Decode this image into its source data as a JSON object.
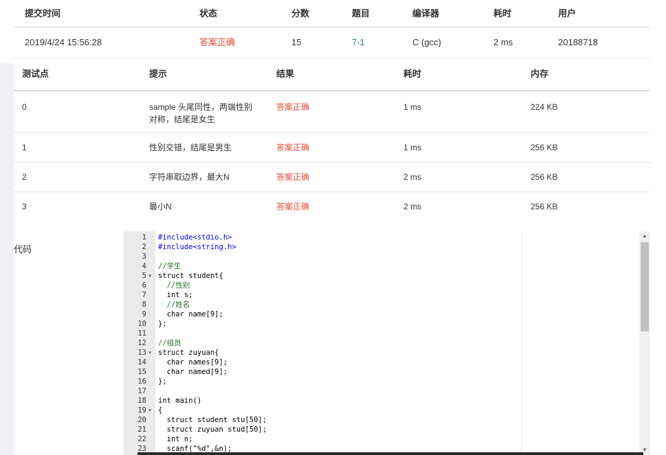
{
  "summary": {
    "headers": [
      "提交时间",
      "状态",
      "分数",
      "题目",
      "编译器",
      "耗时",
      "用户"
    ],
    "row": {
      "time": "2019/4/24 15:56:28",
      "status": "答案正确",
      "score": "15",
      "problem": "7-1",
      "compiler": "C (gcc)",
      "elapsed": "2 ms",
      "user": "20188718"
    }
  },
  "testpoints": {
    "headers": [
      "测试点",
      "提示",
      "结果",
      "耗时",
      "内存"
    ],
    "rows": [
      {
        "id": "0",
        "hint": "sample 头尾同性，两端性别对称，结尾是女生",
        "result": "答案正确",
        "time": "1 ms",
        "memory": "224 KB"
      },
      {
        "id": "1",
        "hint": "性别交错，结尾是男生",
        "result": "答案正确",
        "time": "1 ms",
        "memory": "256 KB"
      },
      {
        "id": "2",
        "hint": "字符串取边界，最大N",
        "result": "答案正确",
        "time": "2 ms",
        "memory": "256 KB"
      },
      {
        "id": "3",
        "hint": "最小N",
        "result": "答案正确",
        "time": "2 ms",
        "memory": "256 KB"
      }
    ]
  },
  "code_label": "代码",
  "code_lines": [
    {
      "n": "1",
      "text": "#include<stdio.h>",
      "kind": "inc"
    },
    {
      "n": "2",
      "text": "#include<string.h>",
      "kind": "inc"
    },
    {
      "n": "3",
      "text": "",
      "kind": ""
    },
    {
      "n": "4",
      "text": "//学生",
      "kind": "cm"
    },
    {
      "n": "5",
      "text": "struct student{",
      "kind": "",
      "fold": true
    },
    {
      "n": "6",
      "text": "  //性别",
      "kind": "cm"
    },
    {
      "n": "7",
      "text": "  int s;",
      "kind": ""
    },
    {
      "n": "8",
      "text": "  //姓名",
      "kind": "cm"
    },
    {
      "n": "9",
      "text": "  char name[9];",
      "kind": ""
    },
    {
      "n": "10",
      "text": "};",
      "kind": ""
    },
    {
      "n": "11",
      "text": "",
      "kind": ""
    },
    {
      "n": "12",
      "text": "//组员",
      "kind": "cm"
    },
    {
      "n": "13",
      "text": "struct zuyuan{",
      "kind": "",
      "fold": true
    },
    {
      "n": "14",
      "text": "  char names[9];",
      "kind": ""
    },
    {
      "n": "15",
      "text": "  char named[9];",
      "kind": ""
    },
    {
      "n": "16",
      "text": "};",
      "kind": ""
    },
    {
      "n": "17",
      "text": "",
      "kind": ""
    },
    {
      "n": "18",
      "text": "int main()",
      "kind": ""
    },
    {
      "n": "19",
      "text": "{",
      "kind": "",
      "fold": true
    },
    {
      "n": "20",
      "text": "  struct student stu[50];",
      "kind": ""
    },
    {
      "n": "21",
      "text": "  struct zuyuan stud[50];",
      "kind": ""
    },
    {
      "n": "22",
      "text": "  int n;",
      "kind": ""
    },
    {
      "n": "23",
      "text": "  scanf(\"%d\",&n);",
      "kind": ""
    }
  ],
  "colors": {
    "accepted": "#e74c3c",
    "link": "#2d6eb5"
  },
  "icons": {
    "fold": "fold-arrow-icon",
    "scroll_up": "chevron-up-icon",
    "scroll_down": "chevron-down-icon"
  }
}
